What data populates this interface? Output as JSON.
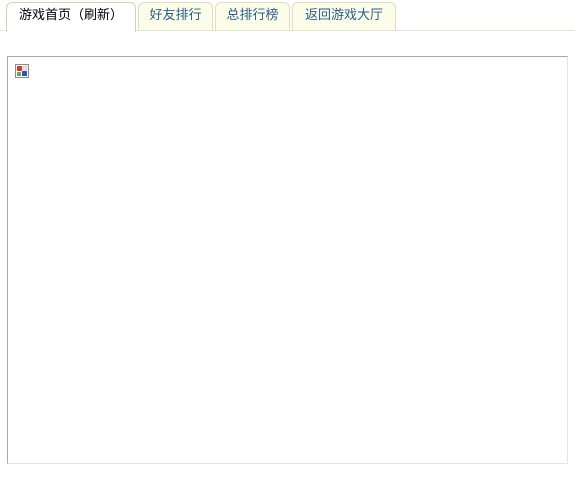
{
  "tabs": [
    {
      "label": "游戏首页（刷新）",
      "active": true
    },
    {
      "label": "好友排行",
      "active": false
    },
    {
      "label": "总排行榜",
      "active": false
    },
    {
      "label": "返回游戏大厅",
      "active": false
    }
  ],
  "content": {
    "image_icon": "broken-image-icon"
  },
  "colors": {
    "tab_inactive_bg": "#fbfde9",
    "tab_inactive_text": "#2a5d8a",
    "tab_active_text": "#000000",
    "tab_border": "#d9dfc2",
    "frame_border": "#a9a9a9"
  }
}
